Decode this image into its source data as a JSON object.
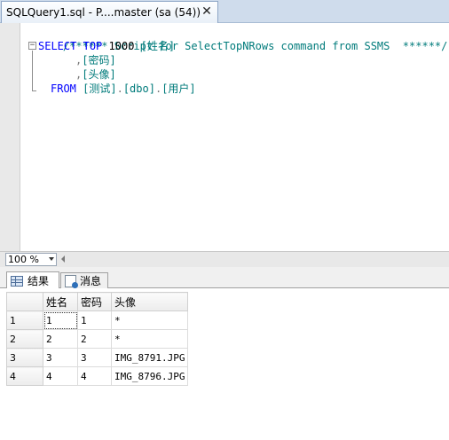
{
  "document_tab": {
    "title": "SQLQuery1.sql - P....master (sa (54))",
    "close_glyph": "✕"
  },
  "editor": {
    "lines": {
      "comment": "/****** Script for SelectTopNRows command from SSMS  ******/",
      "select_kw": "SELECT",
      "top_kw": "TOP",
      "top_n": "1000",
      "col1": "[姓名]",
      "comma": ",",
      "col2": "[密码]",
      "col3": "[头像]",
      "from_kw": "FROM",
      "table_db": "[测试]",
      "table_schema": "[dbo]",
      "table_name": "[用户]",
      "dot": "."
    },
    "collapse_glyph": "−"
  },
  "zoom": {
    "value": "100 %"
  },
  "results_tabs": {
    "results_label": "结果",
    "messages_label": "消息"
  },
  "results_grid": {
    "columns": [
      "姓名",
      "密码",
      "头像"
    ],
    "rows": [
      {
        "num": "1",
        "cells": [
          "1",
          "1",
          "*"
        ]
      },
      {
        "num": "2",
        "cells": [
          "2",
          "2",
          "*"
        ]
      },
      {
        "num": "3",
        "cells": [
          "3",
          "3",
          "IMG_8791.JPG"
        ]
      },
      {
        "num": "4",
        "cells": [
          "4",
          "4",
          "IMG_8796.JPG"
        ]
      }
    ]
  },
  "colors": {
    "keyword": "#0000ff",
    "comment": "#007b7b",
    "identifier": "#007b7b",
    "tab_strip": "#cfdcec"
  }
}
